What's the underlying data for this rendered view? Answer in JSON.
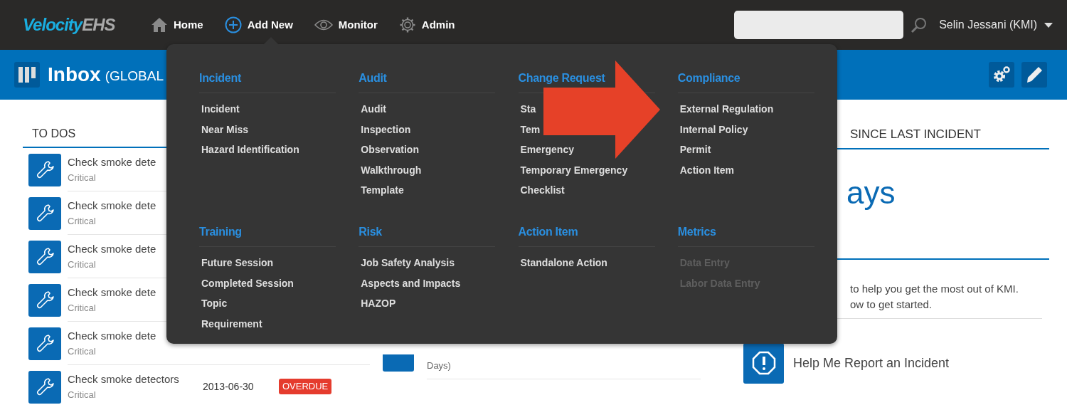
{
  "brand": {
    "name": "Velocity",
    "suffix": "EHS"
  },
  "nav": [
    {
      "label": "Home",
      "kind": "home",
      "selected": false
    },
    {
      "label": "Add New",
      "kind": "add",
      "selected": true
    },
    {
      "label": "Monitor",
      "kind": "eye",
      "selected": false
    },
    {
      "label": "Admin",
      "kind": "gear",
      "selected": false
    }
  ],
  "user": "Selin Jessani (KMI)",
  "page": {
    "title": "Inbox",
    "subtitle": "(GLOBAL"
  },
  "todos": {
    "heading": "TO DOS",
    "items": [
      {
        "title": "Check smoke dete",
        "priority": "Critical"
      },
      {
        "title": "Check smoke dete",
        "priority": "Critical"
      },
      {
        "title": "Check smoke dete",
        "priority": "Critical"
      },
      {
        "title": "Check smoke dete",
        "priority": "Critical"
      },
      {
        "title": "Check smoke dete",
        "priority": "Critical"
      },
      {
        "title": "Check smoke detectors",
        "priority": "Critical",
        "due": "2013-06-30",
        "status": "OVERDUE"
      }
    ]
  },
  "middle": {
    "text": "Days)"
  },
  "incident_counter": {
    "heading": "SINCE LAST INCIDENT",
    "value": "ays"
  },
  "help": {
    "lines": [
      "to help you get the most out of KMI.",
      "ow to get started."
    ],
    "action": "Help Me Report an Incident"
  },
  "add_menu": {
    "groups": [
      {
        "title": "Incident",
        "items": [
          {
            "label": "Incident",
            "disabled": false
          },
          {
            "label": "Near Miss",
            "disabled": false
          },
          {
            "label": "Hazard Identification",
            "disabled": false
          }
        ]
      },
      {
        "title": "Audit",
        "items": [
          {
            "label": "Audit",
            "disabled": false
          },
          {
            "label": "Inspection",
            "disabled": false
          },
          {
            "label": "Observation",
            "disabled": false
          },
          {
            "label": "Walkthrough",
            "disabled": false
          },
          {
            "label": "Template",
            "disabled": false
          }
        ]
      },
      {
        "title": "Change Request",
        "items": [
          {
            "label": "Sta",
            "disabled": false
          },
          {
            "label": "Tem",
            "disabled": false
          },
          {
            "label": "Emergency",
            "disabled": false
          },
          {
            "label": "Temporary Emergency",
            "disabled": false
          },
          {
            "label": "Checklist",
            "disabled": false
          }
        ]
      },
      {
        "title": "Compliance",
        "items": [
          {
            "label": "External Regulation",
            "disabled": false
          },
          {
            "label": "Internal Policy",
            "disabled": false
          },
          {
            "label": "Permit",
            "disabled": false
          },
          {
            "label": "Action Item",
            "disabled": false
          }
        ]
      },
      {
        "title": "Training",
        "items": [
          {
            "label": "Future Session",
            "disabled": false
          },
          {
            "label": "Completed Session",
            "disabled": false
          },
          {
            "label": "Topic",
            "disabled": false
          },
          {
            "label": "Requirement",
            "disabled": false
          }
        ]
      },
      {
        "title": "Risk",
        "items": [
          {
            "label": "Job Safety Analysis",
            "disabled": false
          },
          {
            "label": "Aspects and Impacts",
            "disabled": false
          },
          {
            "label": "HAZOP",
            "disabled": false
          }
        ]
      },
      {
        "title": "Action Item",
        "items": [
          {
            "label": "Standalone Action",
            "disabled": false
          }
        ]
      },
      {
        "title": "Metrics",
        "items": [
          {
            "label": "Data Entry",
            "disabled": true
          },
          {
            "label": "Labor Data Entry",
            "disabled": true
          }
        ]
      }
    ]
  }
}
